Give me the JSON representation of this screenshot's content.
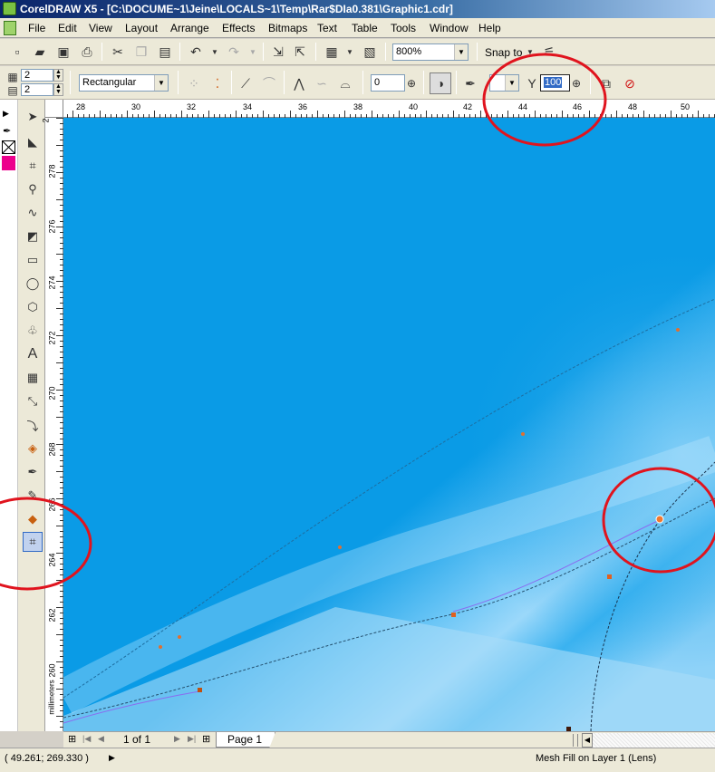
{
  "window": {
    "title": "CorelDRAW X5 - [C:\\DOCUME~1\\Jeine\\LOCALS~1\\Temp\\Rar$DIa0.381\\Graphic1.cdr]"
  },
  "menu": [
    "File",
    "Edit",
    "View",
    "Layout",
    "Arrange",
    "Effects",
    "Bitmaps",
    "Text",
    "Table",
    "Tools",
    "Window",
    "Help"
  ],
  "toolbar": {
    "zoom_value": "800%",
    "snap_label": "Snap to"
  },
  "propertybar": {
    "grid_cols": "2",
    "grid_rows": "2",
    "selection_mode": "Rectangular",
    "smoothness": "0",
    "transparency": "100"
  },
  "ruler": {
    "h_ticks": [
      "28",
      "30",
      "32",
      "34",
      "36",
      "38",
      "40",
      "42",
      "44",
      "46",
      "48",
      "50"
    ],
    "v_ticks": [
      "278",
      "276",
      "274",
      "272",
      "270",
      "268",
      "266",
      "264",
      "262",
      "260"
    ],
    "v_top_partial": "2",
    "units": "millimeters"
  },
  "pages": {
    "counter": "1 of 1",
    "tab": "Page 1"
  },
  "status": {
    "coords": "( 49.261; 269.330 )",
    "object_info": "Mesh Fill on Layer 1  (Lens)"
  },
  "colors": {
    "canvas_blue": "#0a9be6",
    "highlight_blue": "#9bd8fa",
    "annotation_red": "#e0141e",
    "palette_magenta": "#ec008c"
  }
}
